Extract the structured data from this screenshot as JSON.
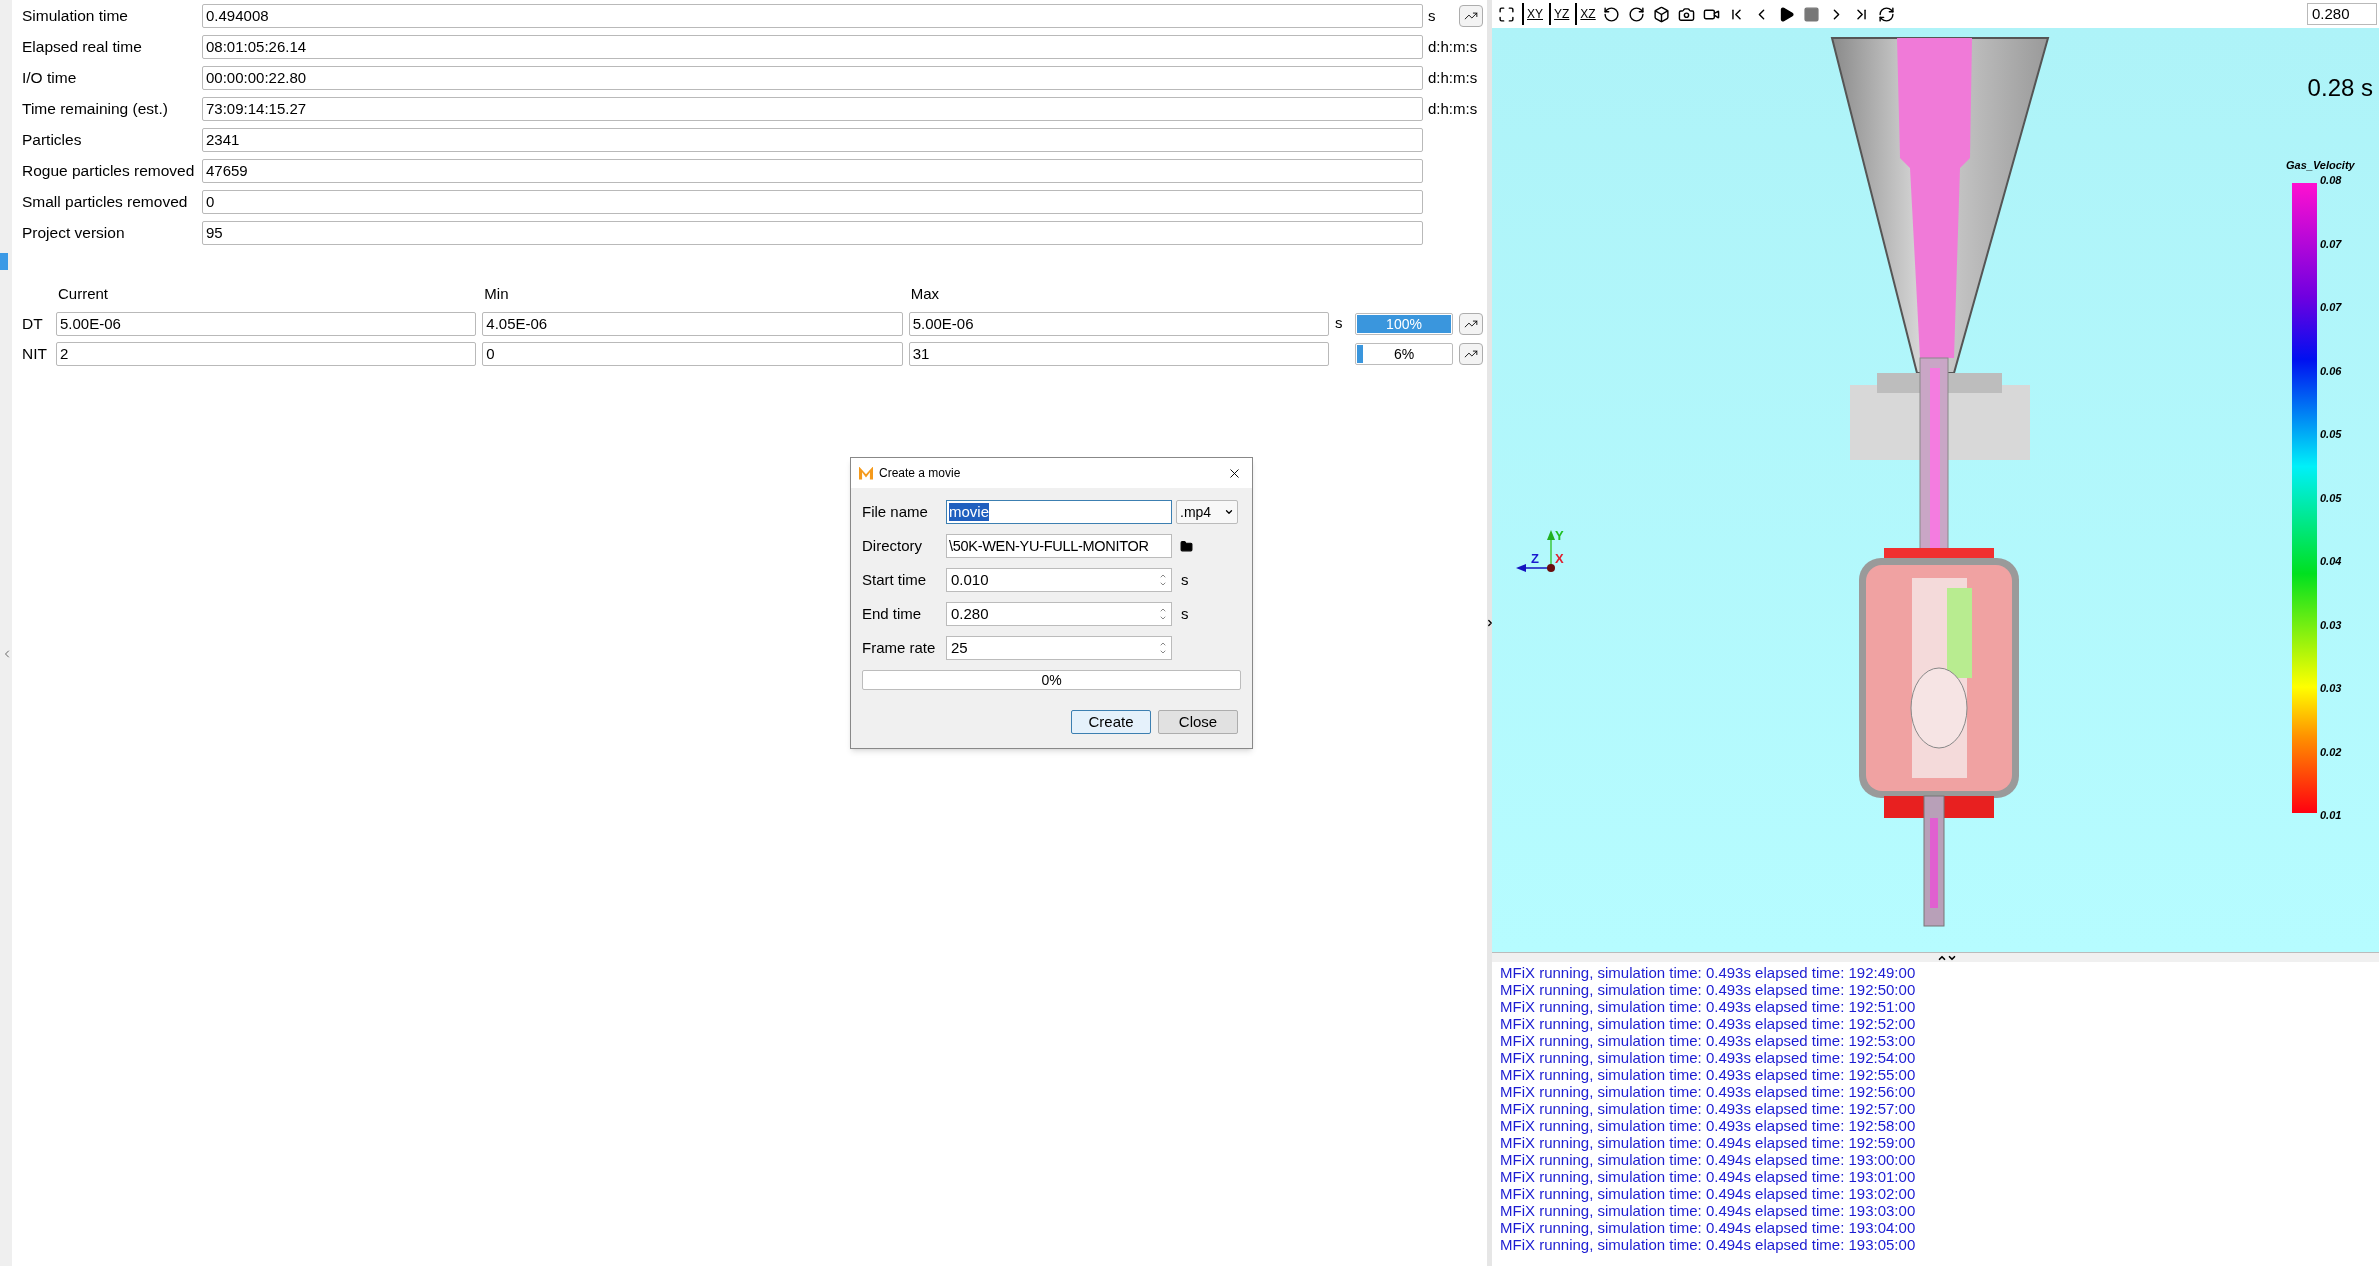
{
  "status_fields": [
    {
      "label": "Simulation time",
      "value": "0.494008",
      "unit": "s",
      "plot_button": true
    },
    {
      "label": "Elapsed real time",
      "value": "08:01:05:26.14",
      "unit": "d:h:m:s",
      "plot_button": false
    },
    {
      "label": "I/O time",
      "value": "00:00:00:22.80",
      "unit": "d:h:m:s",
      "plot_button": false
    },
    {
      "label": "Time remaining (est.)",
      "value": "73:09:14:15.27",
      "unit": "d:h:m:s",
      "plot_button": false
    },
    {
      "label": "Particles",
      "value": "2341",
      "plot_button": false
    },
    {
      "label": "Rogue particles removed",
      "value": "47659",
      "plot_button": false
    },
    {
      "label": "Small particles removed",
      "value": "0",
      "plot_button": false
    },
    {
      "label": "Project version",
      "value": "95",
      "plot_button": false
    }
  ],
  "iterations": {
    "columns": [
      "Current",
      "Min",
      "Max"
    ],
    "rows": [
      {
        "label": "DT",
        "values": [
          "5.00E-06",
          "4.05E-06",
          "5.00E-06"
        ],
        "unit": "s",
        "level": 1,
        "reading": "100%"
      },
      {
        "label": "NIT",
        "values": [
          "2",
          "0",
          "31"
        ],
        "level": 0.06,
        "reading": "6%"
      }
    ]
  },
  "toolbar": {
    "view_buttons": [
      "XY",
      "YZ",
      "XZ"
    ],
    "time_field": "0.280"
  },
  "viewer": {
    "time_label": "0.28 s",
    "legend": {
      "title": "Gas_Velocity",
      "ticks": [
        "0.08",
        "0.07",
        "0.07",
        "0.06",
        "0.05",
        "0.05",
        "0.04",
        "0.03",
        "0.03",
        "0.02",
        "0.01"
      ]
    },
    "axes": {
      "y": "Y",
      "z": "Z",
      "x": "X"
    }
  },
  "log": [
    "MFiX running, simulation time: 0.493s elapsed time: 192:49:00",
    "MFiX running, simulation time: 0.493s elapsed time: 192:50:00",
    "MFiX running, simulation time: 0.493s elapsed time: 192:51:00",
    "MFiX running, simulation time: 0.493s elapsed time: 192:52:00",
    "MFiX running, simulation time: 0.493s elapsed time: 192:53:00",
    "MFiX running, simulation time: 0.493s elapsed time: 192:54:00",
    "MFiX running, simulation time: 0.493s elapsed time: 192:55:00",
    "MFiX running, simulation time: 0.493s elapsed time: 192:56:00",
    "MFiX running, simulation time: 0.493s elapsed time: 192:57:00",
    "MFiX running, simulation time: 0.493s elapsed time: 192:58:00",
    "MFiX running, simulation time: 0.494s elapsed time: 192:59:00",
    "MFiX running, simulation time: 0.494s elapsed time: 193:00:00",
    "MFiX running, simulation time: 0.494s elapsed time: 193:01:00",
    "MFiX running, simulation time: 0.494s elapsed time: 193:02:00",
    "MFiX running, simulation time: 0.494s elapsed time: 193:03:00",
    "MFiX running, simulation time: 0.494s elapsed time: 193:04:00",
    "MFiX running, simulation time: 0.494s elapsed time: 193:05:00"
  ],
  "dialog": {
    "title": "Create a movie",
    "fields": [
      {
        "kind": "name",
        "label": "File name",
        "value": "movie",
        "format": ".mp4"
      },
      {
        "kind": "directory",
        "label": "Directory",
        "value": "\\50K-WEN-YU-FULL-MONITOR"
      },
      {
        "kind": "spin",
        "label": "Start time",
        "value": "0.010",
        "unit": "s"
      },
      {
        "kind": "spin",
        "label": "End time",
        "value": "0.280",
        "unit": "s"
      },
      {
        "kind": "spin",
        "label": "Frame rate",
        "value": "25"
      }
    ],
    "progress": {
      "level": 0,
      "reading": "0%"
    },
    "buttons": [
      {
        "label": "Create",
        "default": true
      },
      {
        "label": "Close",
        "default": false
      }
    ]
  }
}
